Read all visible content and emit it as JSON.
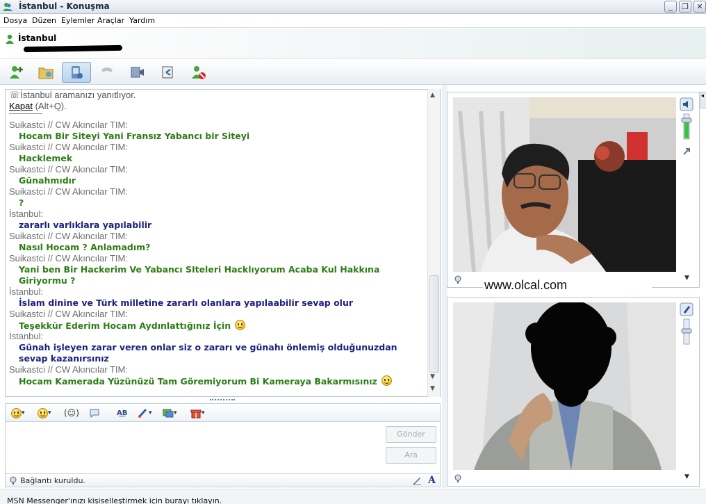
{
  "window": {
    "title": "İstanbul - Konuşma",
    "minimize_label": "_",
    "maximize_label": "❐",
    "close_label": "✕"
  },
  "menu": [
    "Dosya",
    "Düzen",
    "Eylemler",
    "Araçlar",
    "Yardım"
  ],
  "contact": {
    "name": "İstanbul"
  },
  "toolbar": {
    "buttons": [
      "add-contact",
      "share-files",
      "video-call",
      "end-call",
      "webcam",
      "remote-assistance",
      "block-contact"
    ],
    "active": "video-call"
  },
  "history": {
    "system_notice": "İstanbul aramanızı yanıtlıyor.",
    "hangup_link": "Kapat",
    "hangup_shortcut": " (Alt+Q).",
    "entries": [
      {
        "sender": "Suikastci // CW Akıncılar TIM:",
        "text": "Hocam Bir Siteyi Yani Fransız Yabancı bir Siteyi",
        "color": "green"
      },
      {
        "sender": "Suikastci // CW Akıncılar TIM:",
        "text": "Hacklemek",
        "color": "green"
      },
      {
        "sender": "Suikastci // CW Akıncılar TIM:",
        "text": "Günahmıdır",
        "color": "green"
      },
      {
        "sender": "Suikastci // CW Akıncılar TIM:",
        "text": "?",
        "color": "green"
      },
      {
        "sender": "İstanbul:",
        "text": "zararlı varlıklara yapılabilir",
        "color": "blue"
      },
      {
        "sender": "Suikastci // CW Akıncılar TIM:",
        "text": "Nasıl Hocam ? Anlamadım?",
        "color": "green"
      },
      {
        "sender": "Suikastci // CW Akıncılar TIM:",
        "text": "Yani ben Bir Hackerim Ve Yabancı SIteleri Hacklıyorum Acaba Kul Hakkına Giriyormu ?",
        "color": "green",
        "wrap": true
      },
      {
        "sender": "İstanbul:",
        "text": "İslam dinine ve Türk milletine zararlı olanlara yapılaabilir sevap olur",
        "color": "blue"
      },
      {
        "sender": "Suikastci // CW Akıncılar TIM:",
        "text": "Teşekkür Ederim Hocam Aydınlattığınız İçin",
        "color": "green",
        "smiley": true
      },
      {
        "sender": "İstanbul:",
        "text": "Günah işleyen zarar veren onlar siz o zararı ve günahı önlemiş olduğunuzdan sevap kazanırsınız",
        "color": "blue",
        "wrap": true
      },
      {
        "sender": "Suikastci // CW Akıncılar TIM:",
        "text": "Hocam Kamerada Yüzünüzü Tam Göremiyorum Bi Kameraya Bakarmısınız",
        "color": "green",
        "smiley": true
      }
    ]
  },
  "input": {
    "send_label": "Gönder",
    "search_label": "Ara"
  },
  "status": {
    "text": "Bağlantı kuruldu.",
    "font_label": "A"
  },
  "footer": {
    "text": "MSN Messenger'ınızı kişiselleştirmek için burayı tıklayın."
  },
  "webcam": {
    "watermark": "www.olcal.com"
  },
  "colors": {
    "green_text": "#2d7d16",
    "blue_text": "#1c1f7e",
    "sender_text": "#6e6e6e"
  }
}
